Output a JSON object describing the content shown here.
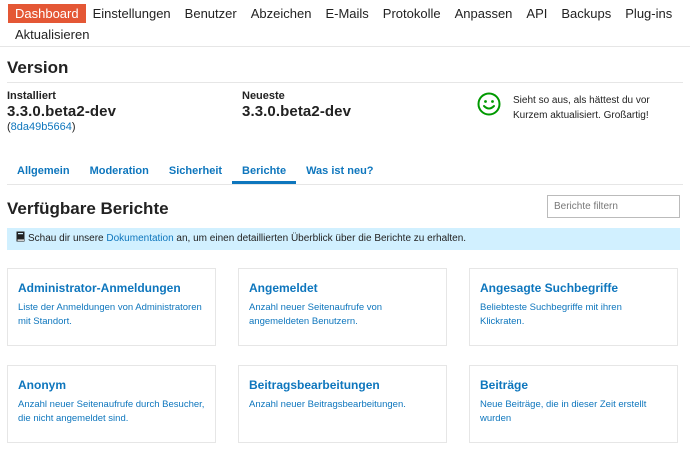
{
  "nav": {
    "items": [
      {
        "label": "Dashboard",
        "active": true
      },
      {
        "label": "Einstellungen"
      },
      {
        "label": "Benutzer"
      },
      {
        "label": "Abzeichen"
      },
      {
        "label": "E-Mails"
      },
      {
        "label": "Protokolle"
      },
      {
        "label": "Anpassen"
      },
      {
        "label": "API"
      },
      {
        "label": "Backups"
      },
      {
        "label": "Plug-ins"
      },
      {
        "label": "Aktualisieren"
      }
    ]
  },
  "version": {
    "title": "Version",
    "installed_label": "Installiert",
    "installed_value": "3.3.0.beta2-dev",
    "commit_open": "(",
    "commit": "8da49b5664",
    "commit_close": ")",
    "latest_label": "Neueste",
    "latest_value": "3.3.0.beta2-dev",
    "status_icon": "smiley-face-icon",
    "status_color": "#009900",
    "status_text": "Sieht so aus, als hättest du vor Kurzem aktualisiert. Großartig!"
  },
  "tabs": [
    {
      "label": "Allgemein"
    },
    {
      "label": "Moderation"
    },
    {
      "label": "Sicherheit"
    },
    {
      "label": "Berichte",
      "active": true
    },
    {
      "label": "Was ist neu?"
    }
  ],
  "reports": {
    "title": "Verfügbare Berichte",
    "filter_placeholder": "Berichte filtern",
    "info_prefix": "Schau dir unsere ",
    "info_link": "Dokumentation",
    "info_suffix": " an, um einen detaillierten Überblick über die Berichte zu erhalten.",
    "cards": [
      {
        "title": "Administrator-Anmeldungen",
        "desc": "Liste der Anmeldungen von Administratoren mit Standort."
      },
      {
        "title": "Angemeldet",
        "desc": "Anzahl neuer Seitenaufrufe von angemeldeten Benutzern."
      },
      {
        "title": "Angesagte Suchbegriffe",
        "desc": "Beliebteste Suchbegriffe mit ihren Klickraten."
      },
      {
        "title": "Anonym",
        "desc": "Anzahl neuer Seitenaufrufe durch Besucher, die nicht angemeldet sind."
      },
      {
        "title": "Beitragsbearbeitungen",
        "desc": "Anzahl neuer Beitragsbearbeitungen."
      },
      {
        "title": "Beiträge",
        "desc": "Neue Beiträge, die in dieser Zeit erstellt wurden"
      }
    ]
  },
  "colors": {
    "accent": "#e45735",
    "link": "#0e76bd",
    "info_bg": "#d1f0ff"
  }
}
